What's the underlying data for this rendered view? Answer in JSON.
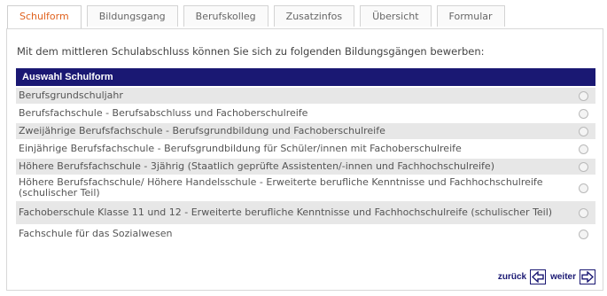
{
  "tabs": [
    {
      "label": "Schulform"
    },
    {
      "label": "Bildungsgang"
    },
    {
      "label": "Berufskolleg"
    },
    {
      "label": "Zusatzinfos"
    },
    {
      "label": "Übersicht"
    },
    {
      "label": "Formular"
    }
  ],
  "intro": "Mit dem mittleren Schulabschluss können Sie sich zu folgenden Bildungsgängen bewerben:",
  "table_header": "Auswahl Schulform",
  "options": [
    {
      "label": "Berufsgrundschuljahr"
    },
    {
      "label": "Berufsfachschule - Berufsabschluss und Fachoberschulreife"
    },
    {
      "label": "Zweijährige Berufsfachschule - Berufsgrundbildung und Fachoberschulreife"
    },
    {
      "label": "Einjährige Berufsfachschule - Berufsgrundbildung für Schüler/innen mit Fachoberschulreife"
    },
    {
      "label": "Höhere Berufsfachschule - 3jährig (Staatlich geprüfte Assistenten/-innen und Fachhochschulreife)"
    },
    {
      "label": "Höhere Berufsfachschule/ Höhere Handelsschule - Erweiterte berufliche Kenntnisse und Fachhochschulreife (schulischer Teil)"
    },
    {
      "label": "Fachoberschule Klasse 11 und 12 - Erweiterte berufliche Kenntnisse und Fachhochschulreife (schulischer Teil)"
    },
    {
      "label": "Fachschule für das Sozialwesen"
    }
  ],
  "nav": {
    "back": "zurück",
    "next": "weiter"
  }
}
